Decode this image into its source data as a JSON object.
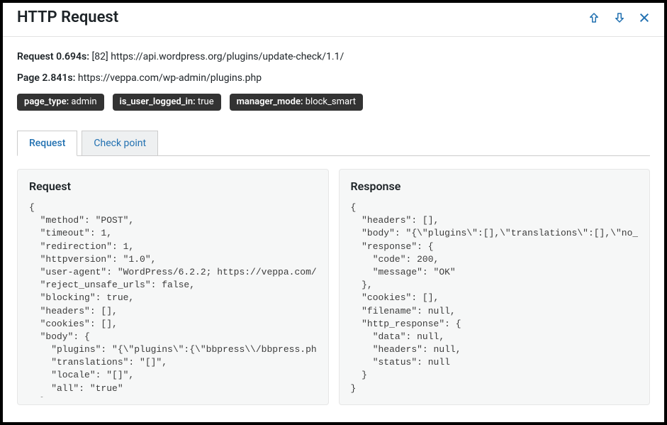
{
  "header": {
    "title": "HTTP Request"
  },
  "summary": {
    "request_label": "Request",
    "request_time": "0.694s:",
    "request_id": "[82]",
    "request_url": "https://api.wordpress.org/plugins/update-check/1.1/",
    "page_label": "Page",
    "page_time": "2.841s:",
    "page_url": "https://veppa.com/wp-admin/plugins.php"
  },
  "chips": [
    {
      "k": "page_type:",
      "v": " admin"
    },
    {
      "k": "is_user_logged_in:",
      "v": " true"
    },
    {
      "k": "manager_mode:",
      "v": " block_smart"
    }
  ],
  "tabs": {
    "request": "Request",
    "checkpoint": "Check point"
  },
  "panels": {
    "request_title": "Request",
    "response_title": "Response",
    "request_body": "{\n  \"method\": \"POST\",\n  \"timeout\": 1,\n  \"redirection\": 1,\n  \"httpversion\": \"1.0\",\n  \"user-agent\": \"WordPress/6.2.2; https://veppa.com/\",\n  \"reject_unsafe_urls\": false,\n  \"blocking\": true,\n  \"headers\": [],\n  \"cookies\": [],\n  \"body\": {\n    \"plugins\": \"{\\\"plugins\\\":{\\\"bbpress\\\\/bbpress.php\\\":{\\\"\n    \"translations\": \"[]\",\n    \"locale\": \"[]\",\n    \"all\": \"true\"\n  }",
    "response_body": "{\n  \"headers\": [],\n  \"body\": \"{\\\"plugins\\\":[],\\\"translations\\\":[],\\\"no_update\\\":{\n  \"response\": {\n    \"code\": 200,\n    \"message\": \"OK\"\n  },\n  \"cookies\": [],\n  \"filename\": null,\n  \"http_response\": {\n    \"data\": null,\n    \"headers\": null,\n    \"status\": null\n  }\n}"
  }
}
